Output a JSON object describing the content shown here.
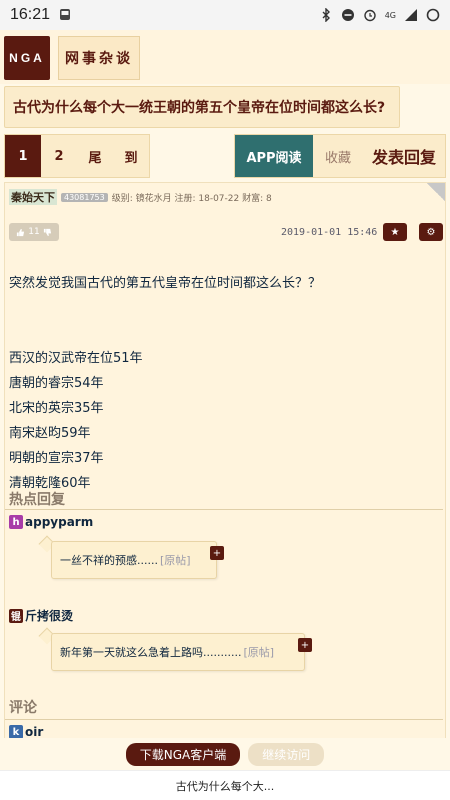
{
  "status": {
    "time": "16:21",
    "signal_label": "4G"
  },
  "topbar": {
    "logo": "NGA",
    "board": "网事杂谈"
  },
  "thread": {
    "title": "古代为什么每个大一统王朝的第五个皇帝在位时间都这么长?"
  },
  "pager": {
    "pages": [
      "1",
      "2",
      "尾",
      "到"
    ]
  },
  "actions": {
    "app_read": "APP阅读",
    "favorite": "收藏",
    "reply": "发表回复"
  },
  "post": {
    "user": "秦始天下",
    "uid": "43081753",
    "meta": "级别: 镜花水月 注册: 18-07-22 财富: 8",
    "votes": "11",
    "date": "2019-01-01 15:46",
    "intro": "突然发觉我国古代的第五代皇帝在位时间都这么长？？",
    "lines": [
      "西汉的汉武帝在位51年",
      "唐朝的睿宗54年",
      "北宋的英宗35年",
      "南宋赵昀59年",
      "明朝的宣宗37年",
      "清朝乾隆60年"
    ]
  },
  "hot": {
    "heading": "热点回复",
    "replies": [
      {
        "avatar": "h",
        "avatar_color": "#a83ca8",
        "user": "appyparm",
        "text": "一丝不祥的预感......",
        "src": "[原帖]"
      },
      {
        "avatar": "锟",
        "avatar_color": "#5a1a10",
        "user": "斤拷很烫",
        "text": "新年第一天就这么急着上路吗...........",
        "src": "[原帖]"
      }
    ]
  },
  "comments": {
    "heading": "评论",
    "first_avatar": "k",
    "first_user": "oir"
  },
  "banner": {
    "download": "下载NGA客户端",
    "continue": "继续访问"
  },
  "footer": {
    "title": "古代为什么每个大..."
  }
}
